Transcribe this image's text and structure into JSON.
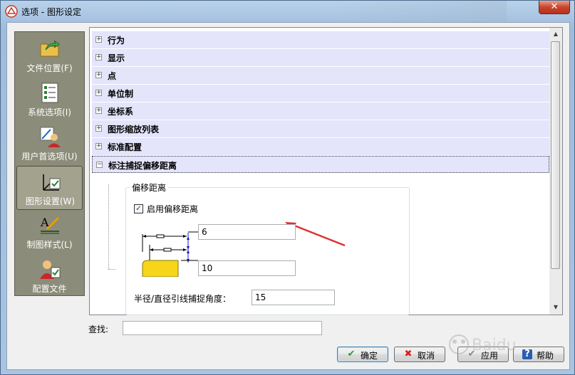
{
  "window": {
    "title": "选项 - 图形设定",
    "close_symbol": "✕"
  },
  "sidebar": {
    "items": [
      {
        "label": "文件位置(F)",
        "icon": "folder-arrow-icon",
        "selected": false
      },
      {
        "label": "系统选项(I)",
        "icon": "checklist-icon",
        "selected": false
      },
      {
        "label": "用户首选项(U)",
        "icon": "user-edit-icon",
        "selected": false
      },
      {
        "label": "图形设置(W)",
        "icon": "graphics-settings-icon",
        "selected": true
      },
      {
        "label": "制图样式(L)",
        "icon": "drafting-style-icon",
        "selected": false
      },
      {
        "label": "配置文件",
        "icon": "user-profile-icon",
        "selected": false
      }
    ]
  },
  "tree": {
    "items": [
      {
        "label": "行为",
        "expander": "+"
      },
      {
        "label": "显示",
        "expander": "+"
      },
      {
        "label": "点",
        "expander": "+"
      },
      {
        "label": "单位制",
        "expander": "+"
      },
      {
        "label": "坐标系",
        "expander": "+"
      },
      {
        "label": "图形缩放列表",
        "expander": "+"
      },
      {
        "label": "标准配置",
        "expander": "+"
      },
      {
        "label": "标注捕捉偏移距离",
        "expander": "−"
      }
    ]
  },
  "offset_group": {
    "title": "偏移距离",
    "enable_label": "启用偏移距离",
    "enable_checked": true,
    "check_mark": "✓",
    "first_offset": "6",
    "second_offset": "10",
    "angle_label": "半径/直径引线捕捉角度：",
    "angle_value": "15"
  },
  "search": {
    "label": "查找:",
    "value": ""
  },
  "buttons": {
    "ok": {
      "label": "确定",
      "icon": "check-icon",
      "symbol": "✔",
      "color": "#2f9a2f"
    },
    "cancel": {
      "label": "取消",
      "icon": "x-icon",
      "symbol": "✖",
      "color": "#d62020"
    },
    "apply": {
      "label": "应用",
      "icon": "apply-icon",
      "symbol": "✔",
      "color": "#8a8a8a"
    },
    "help": {
      "label": "帮助",
      "icon": "help-icon",
      "symbol": "?",
      "color": "#2a5db0"
    }
  },
  "colors": {
    "tree_row_bg": "#e4e4fb",
    "sidebar_bg": "#8c8c7a",
    "annotation_arrow": "#e03030"
  }
}
